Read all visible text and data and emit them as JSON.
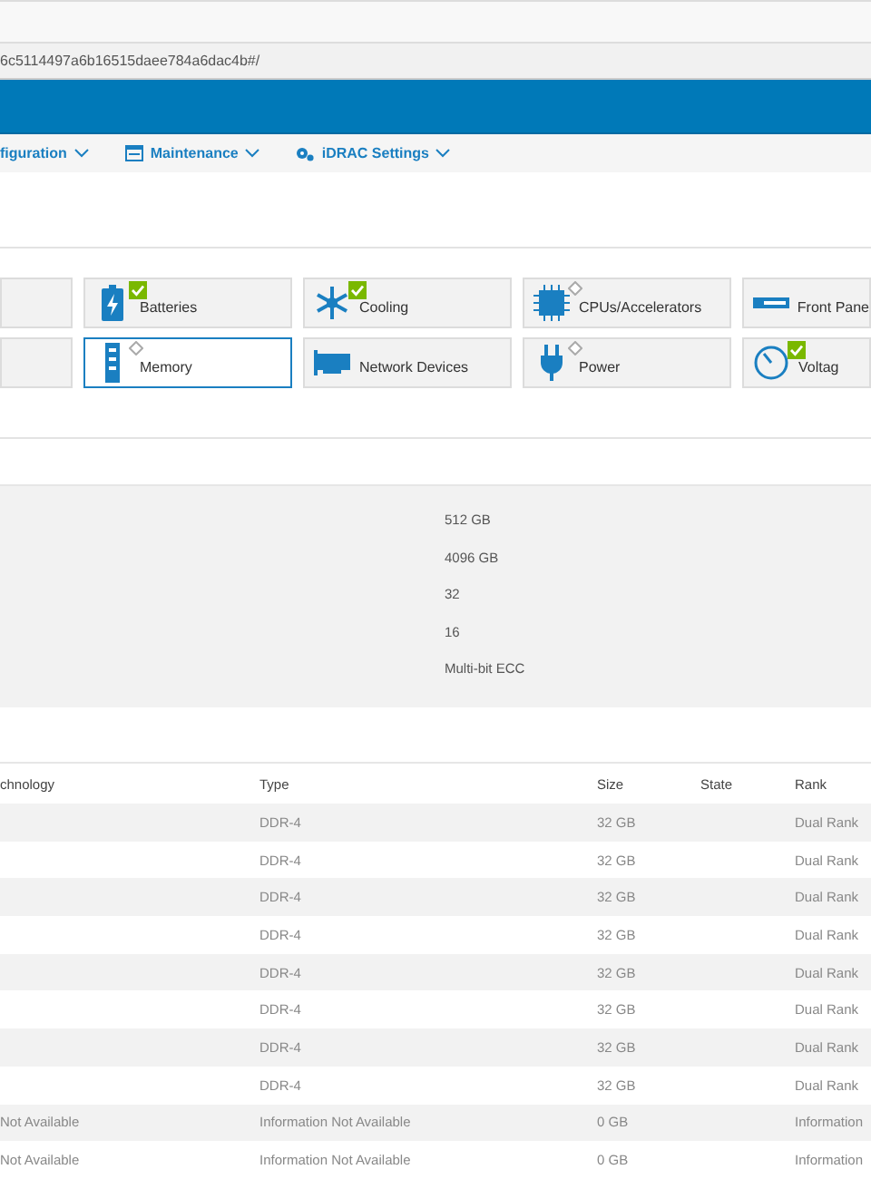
{
  "address_bar": {
    "url": "6c5114497a6b16515daee784a6dac4b#/"
  },
  "nav": [
    {
      "label": "figuration"
    },
    {
      "label": "Maintenance"
    },
    {
      "label": "iDRAC Settings"
    }
  ],
  "tiles": [
    [
      {
        "kind": "plain",
        "selected": false
      },
      {
        "label": "Batteries",
        "kind": "ok",
        "selected": false
      },
      {
        "label": "Cooling",
        "kind": "ok",
        "selected": false
      },
      {
        "label": "CPUs/Accelerators",
        "kind": "unknown",
        "selected": false
      },
      {
        "label": "Front Pane",
        "kind": "plain",
        "selected": false
      }
    ],
    [
      {
        "kind": "plain",
        "selected": false
      },
      {
        "label": "Memory",
        "kind": "unknown",
        "selected": true
      },
      {
        "label": "Network Devices",
        "kind": "plain",
        "selected": false
      },
      {
        "label": "Power",
        "kind": "unknown",
        "selected": false
      },
      {
        "label": "Voltag",
        "kind": "ok",
        "selected": false
      }
    ]
  ],
  "details": [
    "512 GB",
    "4096 GB",
    "32",
    "16",
    "Multi-bit ECC"
  ],
  "table": {
    "columns": [
      "chnology",
      "Type",
      "Size",
      "State",
      "Rank"
    ],
    "rows": [
      [
        "",
        "DDR-4",
        "32 GB",
        "",
        "Dual Rank"
      ],
      [
        "",
        "DDR-4",
        "32 GB",
        "",
        "Dual Rank"
      ],
      [
        "",
        "DDR-4",
        "32 GB",
        "",
        "Dual Rank"
      ],
      [
        "",
        "DDR-4",
        "32 GB",
        "",
        "Dual Rank"
      ],
      [
        "",
        "DDR-4",
        "32 GB",
        "",
        "Dual Rank"
      ],
      [
        "",
        "DDR-4",
        "32 GB",
        "",
        "Dual Rank"
      ],
      [
        "",
        "DDR-4",
        "32 GB",
        "",
        "Dual Rank"
      ],
      [
        "",
        "DDR-4",
        "32 GB",
        "",
        "Dual Rank"
      ],
      [
        "Not Available",
        "Information Not Available",
        "0 GB",
        "",
        "Information"
      ],
      [
        "Not Available",
        "Information Not Available",
        "0 GB",
        "",
        "Information"
      ]
    ]
  }
}
